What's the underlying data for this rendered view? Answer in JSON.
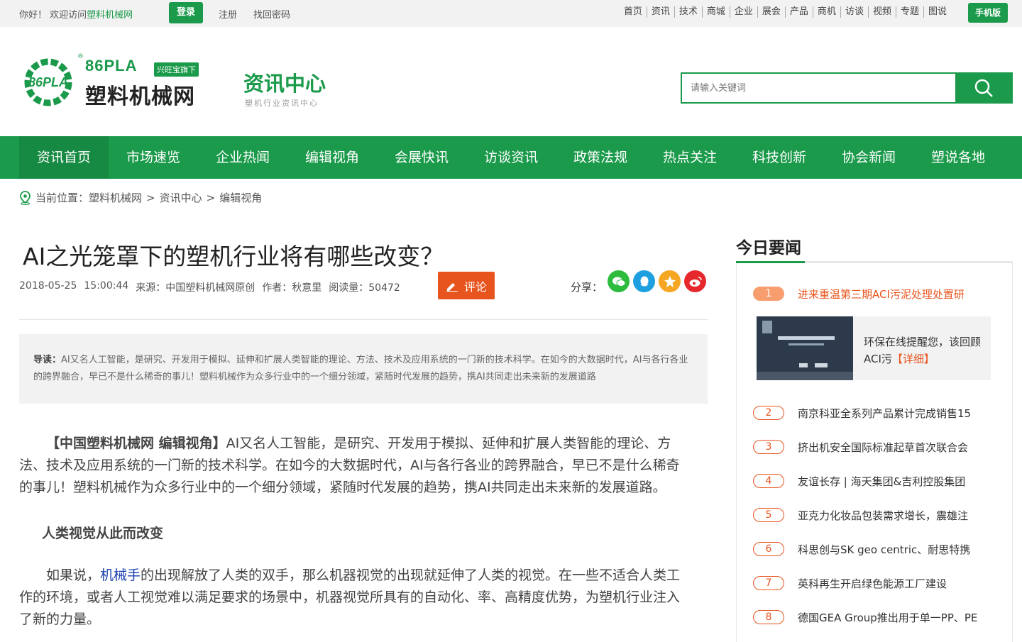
{
  "topbar": {
    "greeting": "你好！ 欢迎访问",
    "site_name": "塑料机械网",
    "login": "登录",
    "register": "注册",
    "recover": "找回密码",
    "nav": [
      "首页",
      "资讯",
      "技术",
      "商城",
      "企业",
      "展会",
      "产品",
      "商机",
      "访谈",
      "视频",
      "专题",
      "图说"
    ],
    "mobile": "手机版"
  },
  "header": {
    "logo_brand": "86PLA",
    "logo_tag": "兴旺宝旗下",
    "logo_name": "塑料机械网",
    "logo_reg": "®",
    "logo_gear_text": "86PLA",
    "section_title": "资讯中心",
    "section_subtitle": "塑机行业资讯中心",
    "search_placeholder": "请输入关键词"
  },
  "mainnav": [
    "资讯首页",
    "市场速览",
    "企业热闻",
    "编辑视角",
    "会展快讯",
    "访谈资讯",
    "政策法规",
    "热点关注",
    "科技创新",
    "协会新闻",
    "塑说各地"
  ],
  "breadcrumb": {
    "label": "当前位置：",
    "items": [
      "塑料机械网",
      "资讯中心",
      "编辑视角"
    ],
    "sep": ">"
  },
  "article": {
    "title": "AI之光笼罩下的塑机行业将有哪些改变？",
    "date": "2018-05-25",
    "time": "15:00:44",
    "source": "来源：中国塑料机械网原创",
    "author": "作者：秋意里",
    "reads": "阅读量：50472",
    "comment": "评论",
    "share": "分享：",
    "lead_label": "导读：",
    "lead_text": "AI又名人工智能，是研究、开发用于模拟、延伸和扩展人类智能的理论、方法、技术及应用系统的一门新的技术科学。在如今的大数据时代，AI与各行各业的跨界融合，早已不是什么稀奇的事儿！塑料机械作为众多行业中的一个细分领域，紧随时代发展的趋势，携AI共同走出未来新的发展道路",
    "p1_open": "【中国",
    "p1_link": "塑料机械",
    "p1_close": "网 编辑视角】",
    "p1_text": "AI又名人工智能，是研究、开发用于模拟、延伸和扩展人类智能的理论、方法、技术及应用系统的一门新的技术科学。在如今的大数据时代，AI与各行各业的跨界融合，早已不是什么稀奇的事儿！塑料机械作为众多行业中的一个细分领域，紧随时代发展的趋势，携AI共同走出未来新的发展道路。",
    "subhead": "人类视觉从此而改变",
    "p2_start": "如果说，",
    "p2_link": "机械手",
    "p2_text": "的出现解放了人类的双手，那么机器视觉的出现就延伸了人类的视觉。在一些不适合人类工作的环境，或者人工视觉难以满足要求的场景中，机器视觉所具有的自动化、率、高精度优势，为塑机行业注入了新的力量。"
  },
  "sidebar": {
    "title": "今日要闻",
    "featured": {
      "text": "环保在线提醒您，该回顾ACI污",
      "more": "【详细】"
    },
    "items": [
      {
        "rank": "1",
        "text": "进来重温第三期ACI污泥处理处置研"
      },
      {
        "rank": "2",
        "text": "南京科亚全系列产品累计完成销售15"
      },
      {
        "rank": "3",
        "text": "挤出机安全国际标准起草首次联合会"
      },
      {
        "rank": "4",
        "text": "友谊长存 | 海天集团&吉利控股集团"
      },
      {
        "rank": "5",
        "text": "亚克力化妆品包装需求增长，震雄注"
      },
      {
        "rank": "6",
        "text": "科思创与SK geo centric、耐思特携"
      },
      {
        "rank": "7",
        "text": "英科再生开启绿色能源工厂建设"
      },
      {
        "rank": "8",
        "text": "德国GEA Group推出用于单一PP、PE"
      }
    ]
  },
  "colors": {
    "brand_green": "#1a9a4a",
    "accent_orange": "#e8541e"
  }
}
